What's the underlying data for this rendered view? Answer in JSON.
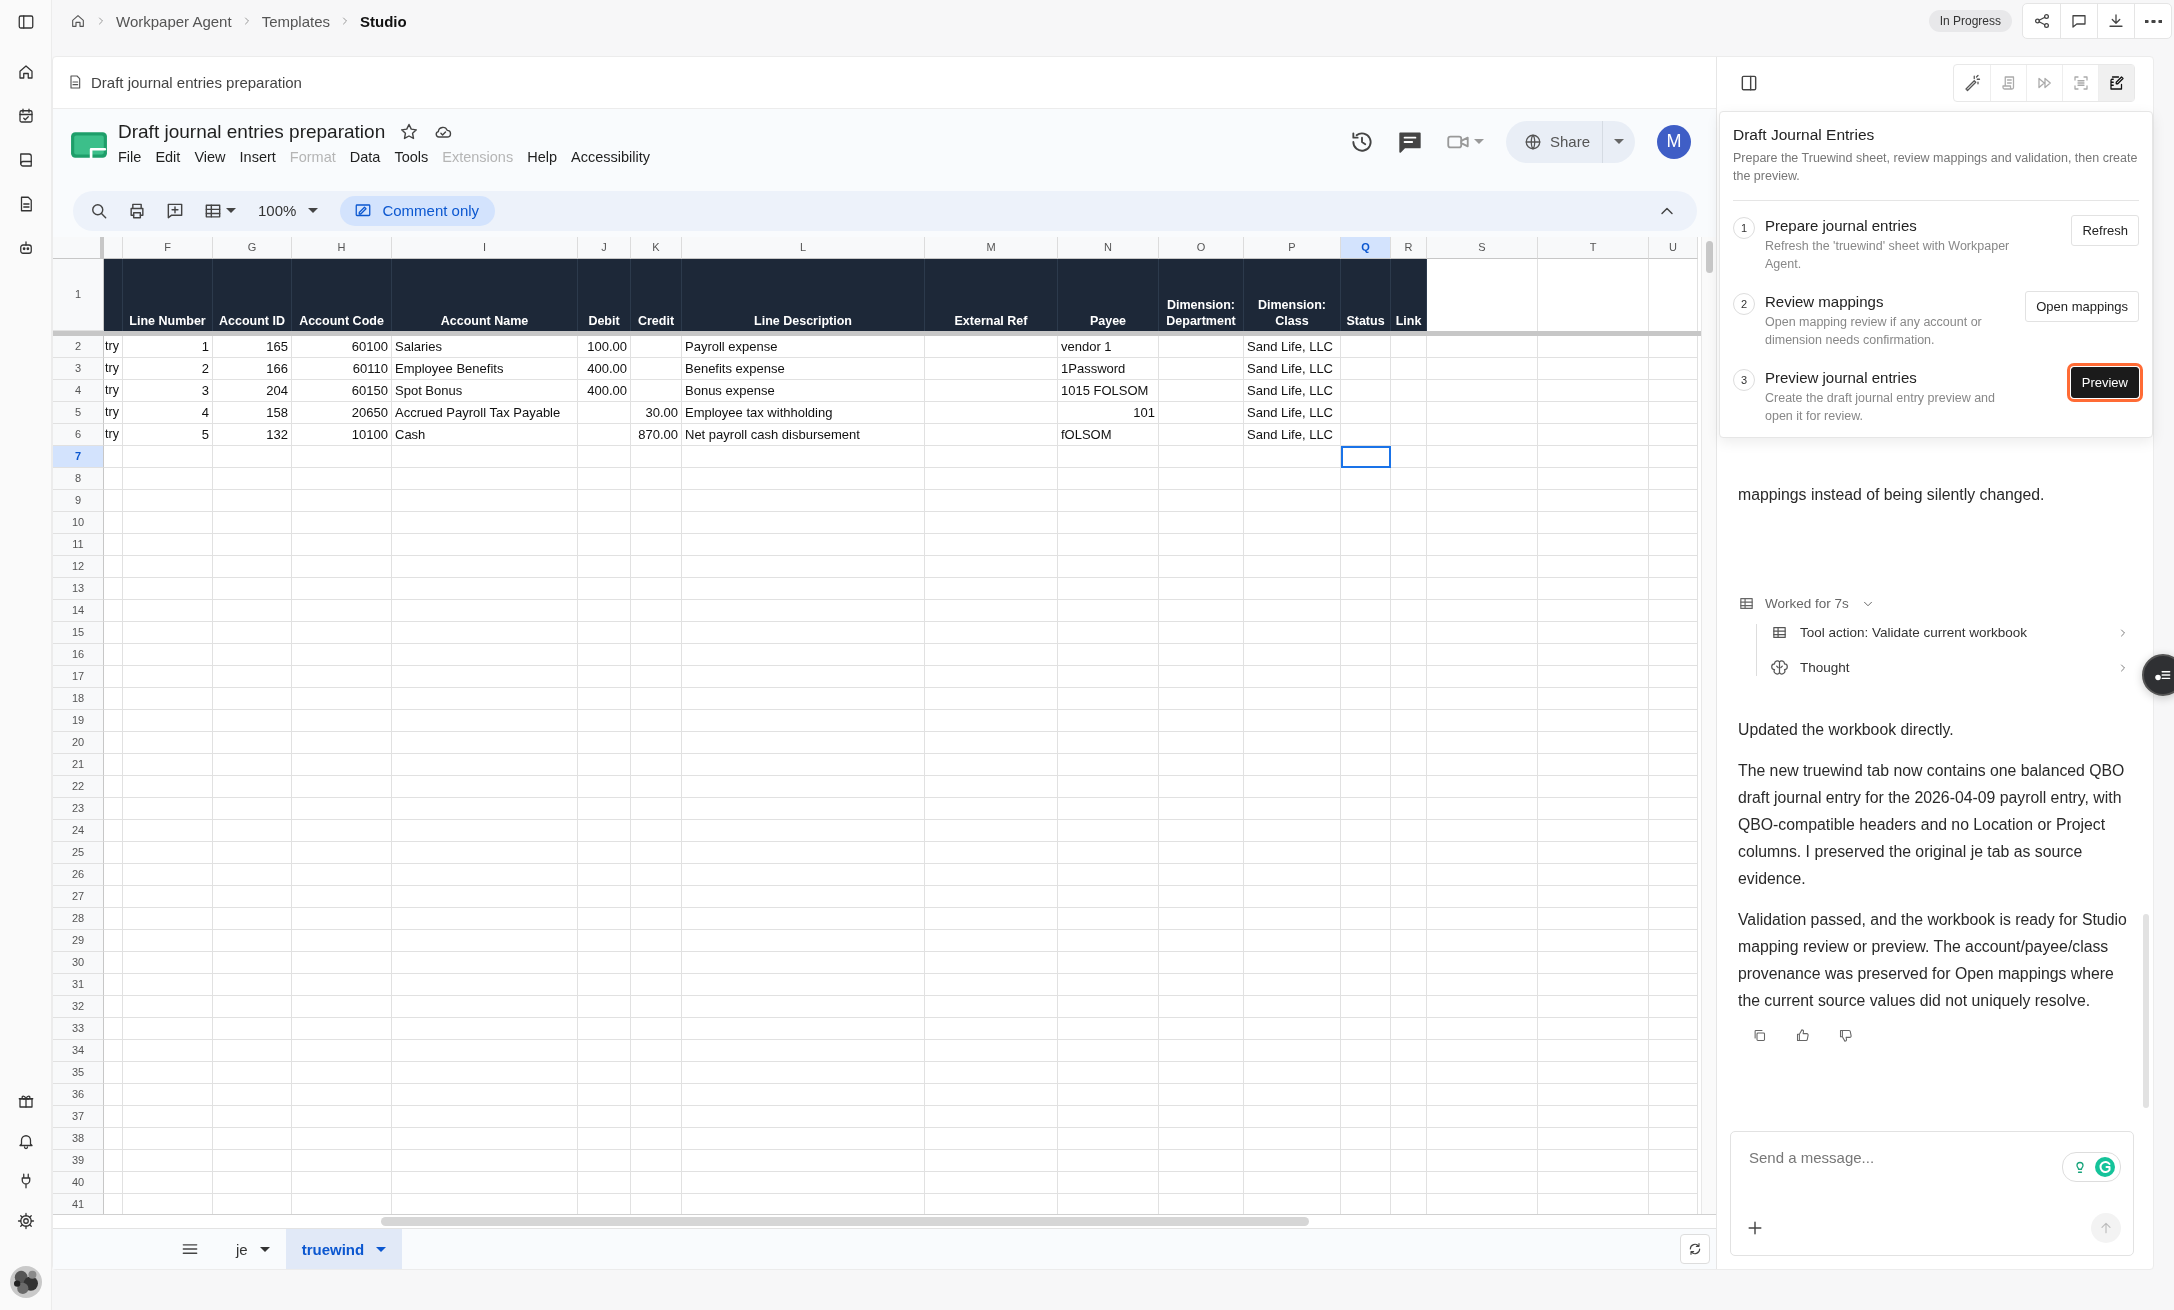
{
  "breadcrumb": [
    {
      "label": "Workpaper Agent",
      "current": false
    },
    {
      "label": "Templates",
      "current": false
    },
    {
      "label": "Studio",
      "current": true
    }
  ],
  "status_badge": "In Progress",
  "document": {
    "title": "Draft journal entries preparation"
  },
  "sheet": {
    "title": "Draft journal entries preparation",
    "menu": [
      {
        "label": "File",
        "disabled": false
      },
      {
        "label": "Edit",
        "disabled": false
      },
      {
        "label": "View",
        "disabled": false
      },
      {
        "label": "Insert",
        "disabled": false
      },
      {
        "label": "Format",
        "disabled": true
      },
      {
        "label": "Data",
        "disabled": false
      },
      {
        "label": "Tools",
        "disabled": false
      },
      {
        "label": "Extensions",
        "disabled": true
      },
      {
        "label": "Help",
        "disabled": false
      },
      {
        "label": "Accessibility",
        "disabled": false
      }
    ],
    "zoom": "100%",
    "mode": "Comment only",
    "share": "Share",
    "avatar": "M",
    "columns": [
      {
        "selected": false
      },
      {
        "letter": "F",
        "header": "Line Number",
        "selected": false
      },
      {
        "letter": "G",
        "header": "Account ID",
        "selected": false
      },
      {
        "letter": "H",
        "header": "Account Code",
        "selected": false
      },
      {
        "letter": "I",
        "header": "Account Name",
        "selected": false
      },
      {
        "letter": "J",
        "header": "Debit",
        "selected": false
      },
      {
        "letter": "K",
        "header": "Credit",
        "selected": false
      },
      {
        "letter": "L",
        "header": "Line Description",
        "selected": false
      },
      {
        "letter": "M",
        "header": "External Ref",
        "selected": false
      },
      {
        "letter": "N",
        "header": "Payee",
        "selected": false
      },
      {
        "letter": "O",
        "header": "Dimension: Department",
        "selected": false
      },
      {
        "letter": "P",
        "header": "Dimension: Class",
        "selected": false
      },
      {
        "letter": "Q",
        "header": "Status",
        "selected": true
      },
      {
        "letter": "R",
        "header": "Link",
        "selected": false
      },
      {
        "letter": "S",
        "selected": false
      },
      {
        "letter": "T",
        "selected": false
      },
      {
        "letter": "U",
        "selected": false
      }
    ],
    "header_row": "1",
    "rows": [
      {
        "number": "2",
        "cells": [
          "try",
          "1",
          "165",
          "60100",
          "Salaries",
          "100.00",
          null,
          "Payroll expense",
          null,
          "vendor 1",
          null,
          "Sand Life, LLC",
          null,
          null
        ]
      },
      {
        "number": "3",
        "cells": [
          "try",
          "2",
          "166",
          "60110",
          "Employee Benefits",
          "400.00",
          null,
          "Benefits expense",
          null,
          "1Password",
          null,
          "Sand Life, LLC",
          null,
          null
        ]
      },
      {
        "number": "4",
        "cells": [
          "try",
          "3",
          "204",
          "60150",
          "Spot Bonus",
          "400.00",
          null,
          "Bonus expense",
          null,
          "1015 FOLSOM",
          null,
          "Sand Life, LLC",
          null,
          null
        ]
      },
      {
        "number": "5",
        "cells": [
          "try",
          "4",
          "158",
          "20650",
          "Accrued Payroll Tax Payable",
          null,
          "30.00",
          "Employee tax withholding",
          null,
          "101",
          null,
          "Sand Life, LLC",
          null,
          null
        ]
      },
      {
        "number": "6",
        "cells": [
          "try",
          "5",
          "132",
          "10100",
          "Cash",
          null,
          "870.00",
          "Net payroll cash disbursement",
          null,
          "fOLSOM",
          null,
          "Sand Life, LLC",
          null,
          null
        ]
      }
    ],
    "empty_rows": [
      {
        "number": "7",
        "selected": true
      },
      {
        "number": "8",
        "selected": false
      },
      {
        "number": "9",
        "selected": false
      },
      {
        "number": "10",
        "selected": false
      },
      {
        "number": "11",
        "selected": false
      },
      {
        "number": "12",
        "selected": false
      },
      {
        "number": "13",
        "selected": false
      },
      {
        "number": "14",
        "selected": false
      },
      {
        "number": "15",
        "selected": false
      },
      {
        "number": "16",
        "selected": false
      },
      {
        "number": "17",
        "selected": false
      },
      {
        "number": "18",
        "selected": false
      },
      {
        "number": "19",
        "selected": false
      },
      {
        "number": "20",
        "selected": false
      },
      {
        "number": "21",
        "selected": false
      },
      {
        "number": "22",
        "selected": false
      },
      {
        "number": "23",
        "selected": false
      },
      {
        "number": "24",
        "selected": false
      },
      {
        "number": "25",
        "selected": false
      },
      {
        "number": "26",
        "selected": false
      },
      {
        "number": "27",
        "selected": false
      },
      {
        "number": "28",
        "selected": false
      },
      {
        "number": "29",
        "selected": false
      },
      {
        "number": "30",
        "selected": false
      },
      {
        "number": "31",
        "selected": false
      },
      {
        "number": "32",
        "selected": false
      },
      {
        "number": "33",
        "selected": false
      },
      {
        "number": "34",
        "selected": false
      },
      {
        "number": "35",
        "selected": false
      },
      {
        "number": "36",
        "selected": false
      },
      {
        "number": "37",
        "selected": false
      },
      {
        "number": "38",
        "selected": false
      },
      {
        "number": "39",
        "selected": false
      },
      {
        "number": "40",
        "selected": false
      },
      {
        "number": "41",
        "selected": false
      }
    ],
    "tabs": [
      {
        "label": "je",
        "selected": false
      },
      {
        "label": "truewind",
        "selected": true
      }
    ]
  },
  "panel": {
    "tools": [
      {
        "kind": "wand",
        "selected": false
      },
      {
        "kind": "scroll",
        "selected": false
      },
      {
        "kind": "forward",
        "selected": false
      },
      {
        "kind": "scan",
        "selected": false
      },
      {
        "kind": "edit",
        "selected": true
      }
    ],
    "popover": {
      "title": "Draft Journal Entries",
      "description": "Prepare the Truewind sheet, review mappings and validation, then create the preview.",
      "steps": [
        {
          "number": "1",
          "title": "Prepare journal entries",
          "description": "Refresh the 'truewind' sheet with Workpaper Agent.",
          "action": "Refresh",
          "primary": false,
          "focused": false
        },
        {
          "number": "2",
          "title": "Review mappings",
          "description": "Open mapping review if any account or dimension needs confirmation.",
          "action": "Open mappings",
          "primary": false,
          "focused": false
        },
        {
          "number": "3",
          "title": "Preview journal entries",
          "description": "Create the draft journal entry preview and open it for review.",
          "action": "Preview",
          "primary": true,
          "focused": true
        }
      ]
    },
    "chat": {
      "lead": "mappings instead of being silently changed.",
      "activity": {
        "label": "Worked for 7s",
        "expanded": true,
        "items": [
          {
            "kind": "tool",
            "label": "Tool action: Validate current workbook"
          },
          {
            "kind": "thought",
            "label": "Thought"
          }
        ]
      },
      "paragraphs": [
        "Updated the workbook directly.",
        "The new truewind tab now contains one balanced QBO draft journal entry for the 2026-04-09 payroll entry, with QBO-compatible headers and no Location or Project columns. I preserved the original je tab as source evidence.",
        "Validation passed, and the workbook is ready for Studio mapping review or preview. The account/payee/class provenance was preserved for Open mappings where the current source values did not uniquely resolve."
      ],
      "input": {
        "placeholder": "Send a message..."
      }
    }
  }
}
